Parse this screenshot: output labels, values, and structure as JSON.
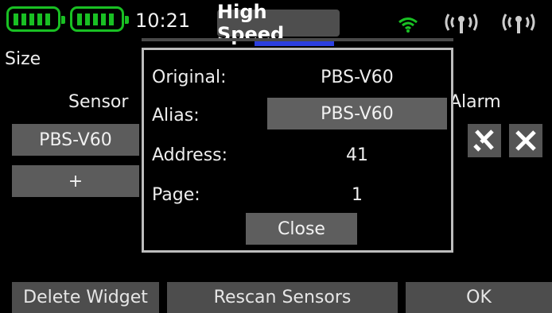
{
  "status_bar": {
    "time": "10:21",
    "mode": "High Speed",
    "battery_color": "#19c023"
  },
  "background_screen": {
    "size_label": "Size",
    "sensor_header": "Sensor",
    "alarm_header": "Alarm",
    "sensor_value": "PBS-V60",
    "add_label": "+",
    "tools_icon": "tools-icon",
    "close_icon": "close-icon"
  },
  "modal": {
    "original_label": "Original:",
    "original_value": "PBS-V60",
    "alias_label": "Alias:",
    "alias_value": "PBS-V60",
    "address_label": "Address:",
    "address_value": "41",
    "page_label": "Page:",
    "page_value": "1",
    "close_label": "Close"
  },
  "bottom_bar": {
    "delete_label": "Delete Widget",
    "rescan_label": "Rescan Sensors",
    "ok_label": "OK"
  },
  "colors": {
    "accent_green": "#19c023",
    "accent_blue": "#2b3fe0"
  }
}
